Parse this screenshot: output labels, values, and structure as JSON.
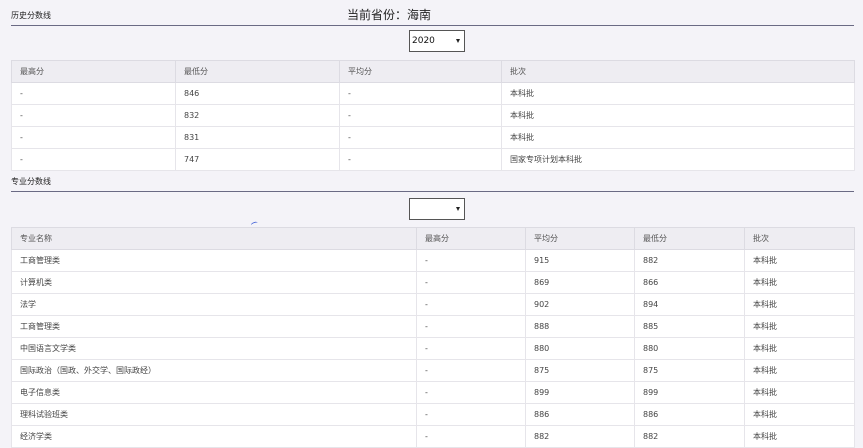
{
  "history": {
    "title": "历史分数线",
    "province": "当前省份：海南",
    "year_select": "2020",
    "columns": [
      "最高分",
      "最低分",
      "平均分",
      "批次"
    ],
    "rows": [
      [
        "-",
        "846",
        "-",
        "本科批"
      ],
      [
        "-",
        "832",
        "-",
        "本科批"
      ],
      [
        "-",
        "831",
        "-",
        "本科批"
      ],
      [
        "-",
        "747",
        "-",
        "国家专项计划本科批"
      ]
    ]
  },
  "major": {
    "title": "专业分数线",
    "select_value": "",
    "columns": [
      "专业名称",
      "最高分",
      "平均分",
      "最低分",
      "批次"
    ],
    "rows": [
      [
        "工商管理类",
        "-",
        "915",
        "882",
        "本科批"
      ],
      [
        "计算机类",
        "-",
        "869",
        "866",
        "本科批"
      ],
      [
        "法学",
        "-",
        "902",
        "894",
        "本科批"
      ],
      [
        "工商管理类",
        "-",
        "888",
        "885",
        "本科批"
      ],
      [
        "中国语言文学类",
        "-",
        "880",
        "880",
        "本科批"
      ],
      [
        "国际政治（国政、外交学、国际政经）",
        "-",
        "875",
        "875",
        "本科批"
      ],
      [
        "电子信息类",
        "-",
        "899",
        "899",
        "本科批"
      ],
      [
        "理科试验班类",
        "-",
        "886",
        "886",
        "本科批"
      ],
      [
        "经济学类",
        "-",
        "882",
        "882",
        "本科批"
      ]
    ]
  }
}
